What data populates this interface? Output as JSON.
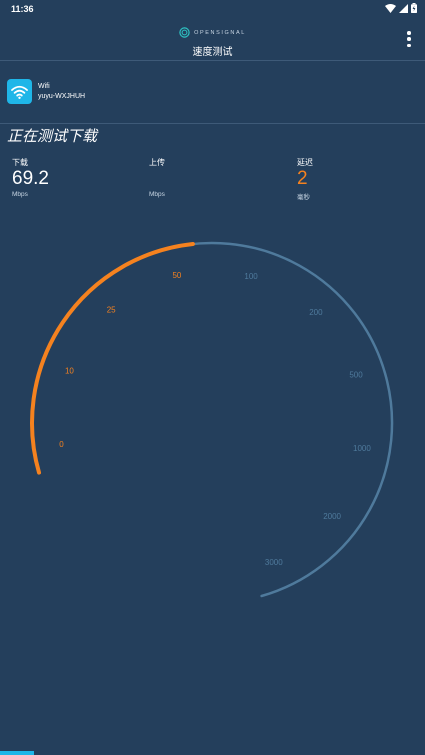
{
  "status_bar": {
    "time": "11:36"
  },
  "header": {
    "brand": "OPENSIGNAL",
    "title": "速度测试"
  },
  "network": {
    "type": "Wifi",
    "name": "yuyu-WXJHUH"
  },
  "testing_title": "正在测试下载",
  "metrics": {
    "download": {
      "label": "下载",
      "value": "69.2",
      "unit": "Mbps"
    },
    "upload": {
      "label": "上传",
      "value": "",
      "unit": "Mbps"
    },
    "latency": {
      "label": "延迟",
      "value": "2",
      "unit": "毫秒"
    }
  },
  "gauge": {
    "tick_labels": [
      "0",
      "10",
      "25",
      "50",
      "100",
      "200",
      "500",
      "1000",
      "2000",
      "3000"
    ],
    "active_ticks": 4,
    "progress_fraction": 0.37
  },
  "colors": {
    "background": "#243f5c",
    "accent_orange": "#f5821f",
    "track_blue": "#4f7a9c",
    "wifi_blue": "#1fb6e8"
  }
}
